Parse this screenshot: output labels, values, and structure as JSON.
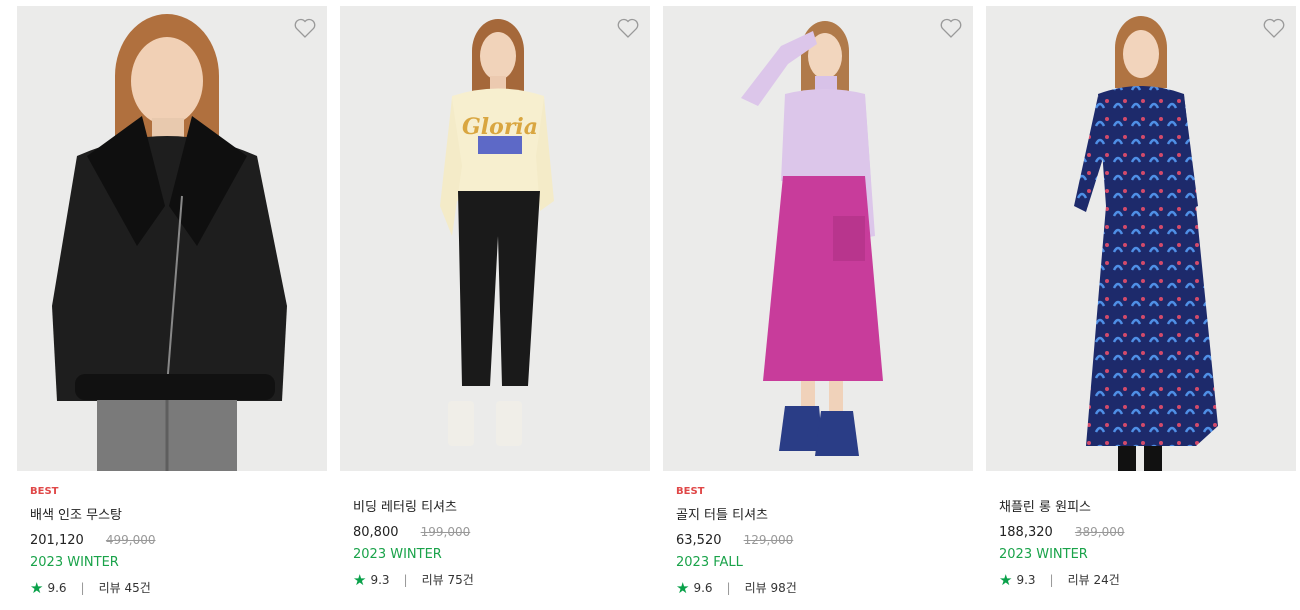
{
  "products": [
    {
      "badge": "BEST",
      "name": "배색 인조 무스탕",
      "price": "201,120",
      "original_price": "499,000",
      "season": "2023 WINTER",
      "rating": "9.6",
      "reviews": "리뷰 45건",
      "image_icon": "jacket-model-photo"
    },
    {
      "badge": "",
      "name": "비딩 레터링 티셔츠",
      "price": "80,800",
      "original_price": "199,000",
      "season": "2023 WINTER",
      "rating": "9.3",
      "reviews": "리뷰 75건",
      "image_icon": "sweatshirt-model-photo"
    },
    {
      "badge": "BEST",
      "name": "골지 터틀 티셔츠",
      "price": "63,520",
      "original_price": "129,000",
      "season": "2023 FALL",
      "rating": "9.6",
      "reviews": "리뷰 98건",
      "image_icon": "turtleneck-model-photo"
    },
    {
      "badge": "",
      "name": "채플린 롱 원피스",
      "price": "188,320",
      "original_price": "389,000",
      "season": "2023 WINTER",
      "rating": "9.3",
      "reviews": "리뷰 24건",
      "image_icon": "long-dress-model-photo"
    }
  ],
  "colors": {
    "badge": "#e04848",
    "season": "#1aa34a",
    "star": "#0aa14a",
    "photo_bg": "#ebebea"
  },
  "icons": {
    "wishlist": "heart-outline-icon",
    "rating": "star-icon"
  }
}
